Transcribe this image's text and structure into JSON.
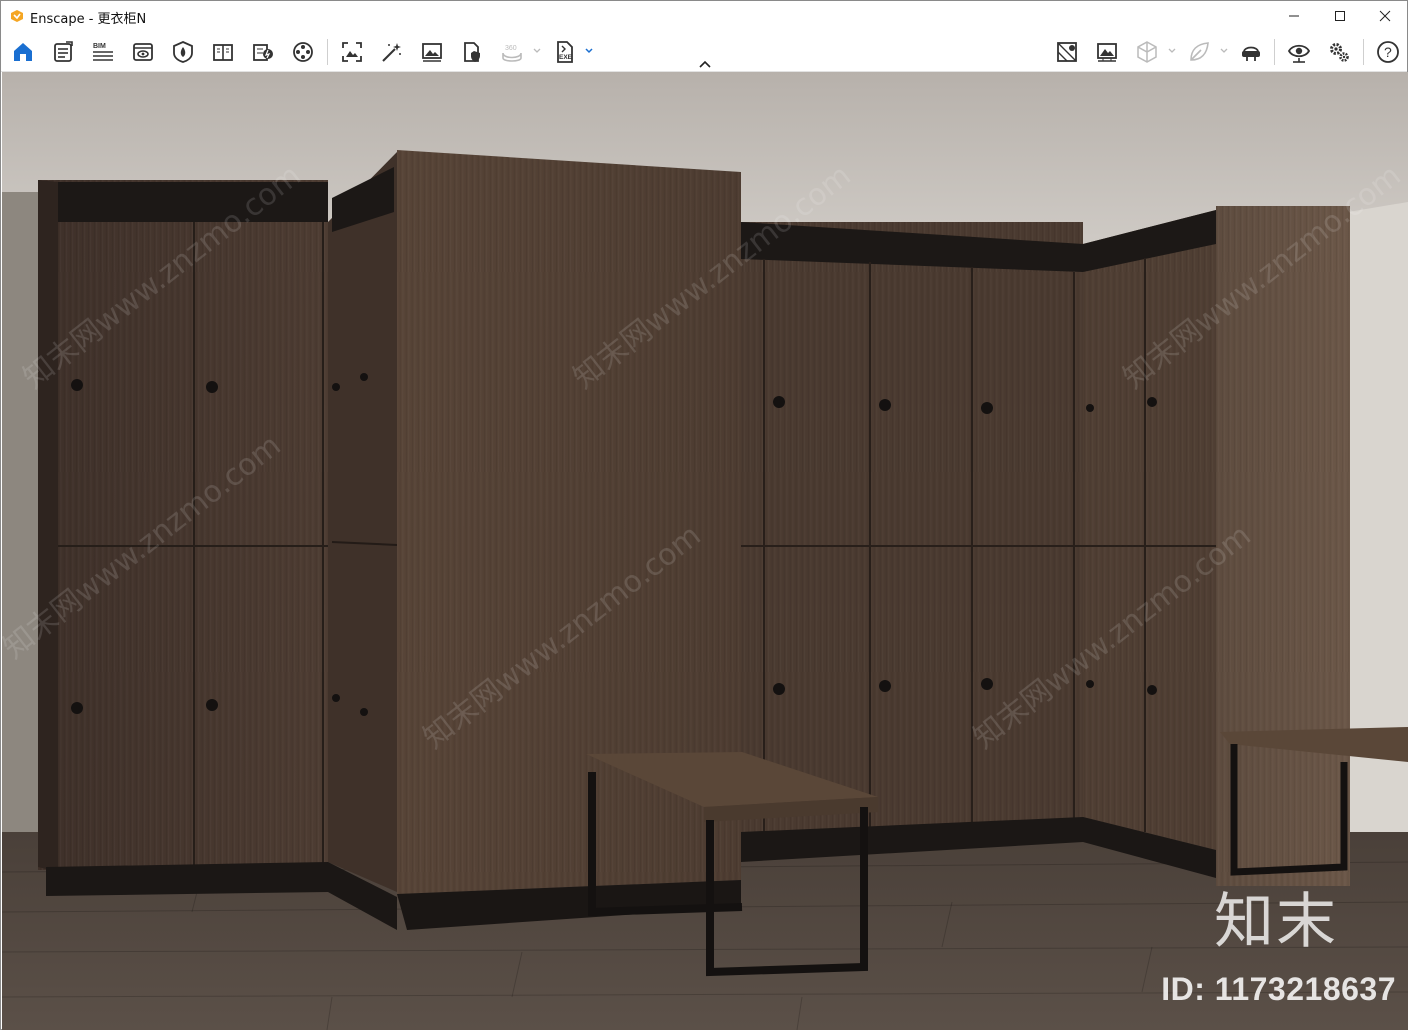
{
  "window": {
    "app_name": "Enscape",
    "title": "Enscape - 更衣柜N",
    "controls": {
      "minimize": "minimize",
      "maximize": "maximize",
      "close": "close"
    }
  },
  "toolbar": {
    "items": [
      {
        "name": "home",
        "icon": "home-icon",
        "active": true
      },
      {
        "name": "asset-library",
        "icon": "asset-library-icon"
      },
      {
        "name": "bim-info",
        "icon": "bim-icon",
        "label": "BIM"
      },
      {
        "name": "views",
        "icon": "views-icon"
      },
      {
        "name": "site-context",
        "icon": "site-context-icon"
      },
      {
        "name": "visual-settings",
        "icon": "book-icon"
      },
      {
        "name": "material-editor",
        "icon": "material-editor-icon"
      },
      {
        "name": "video-editor",
        "icon": "film-reel-icon"
      },
      {
        "name": "screenshot",
        "icon": "screenshot-icon"
      },
      {
        "name": "batch-render",
        "icon": "magic-wand-icon"
      },
      {
        "name": "image-export",
        "icon": "image-icon"
      },
      {
        "name": "file-shield",
        "icon": "file-shield-icon"
      },
      {
        "name": "panorama",
        "icon": "panorama-icon",
        "label": "360",
        "disabled": true
      },
      {
        "name": "export-exe",
        "icon": "exe-export-icon",
        "label": "EXE"
      },
      {
        "name": "map",
        "icon": "map-icon"
      },
      {
        "name": "render-preview",
        "icon": "render-preview-icon"
      },
      {
        "name": "cube-view",
        "icon": "cube-icon",
        "disabled": true
      },
      {
        "name": "leaf",
        "icon": "leaf-icon",
        "disabled": true
      },
      {
        "name": "vr-headset",
        "icon": "vr-headset-icon"
      },
      {
        "name": "visibility",
        "icon": "eye-icon"
      },
      {
        "name": "settings",
        "icon": "gears-icon"
      },
      {
        "name": "help",
        "icon": "help-icon",
        "label": "?"
      }
    ],
    "collapse_icon": "chevron-up-icon"
  },
  "viewport": {
    "description_alt": "rendered locker room scene",
    "watermark_brand": "知末",
    "watermark_id": "ID: 1173218637",
    "watermark_diagonal": "知末网www.znzmo.com"
  },
  "colors": {
    "accent": "#1a6fd1",
    "logo": "#f5a623",
    "wood_dark": "#4b3a30",
    "wood_mid": "#5a473b",
    "ceiling": "#c9c4bf",
    "floor": "#3d342d"
  }
}
